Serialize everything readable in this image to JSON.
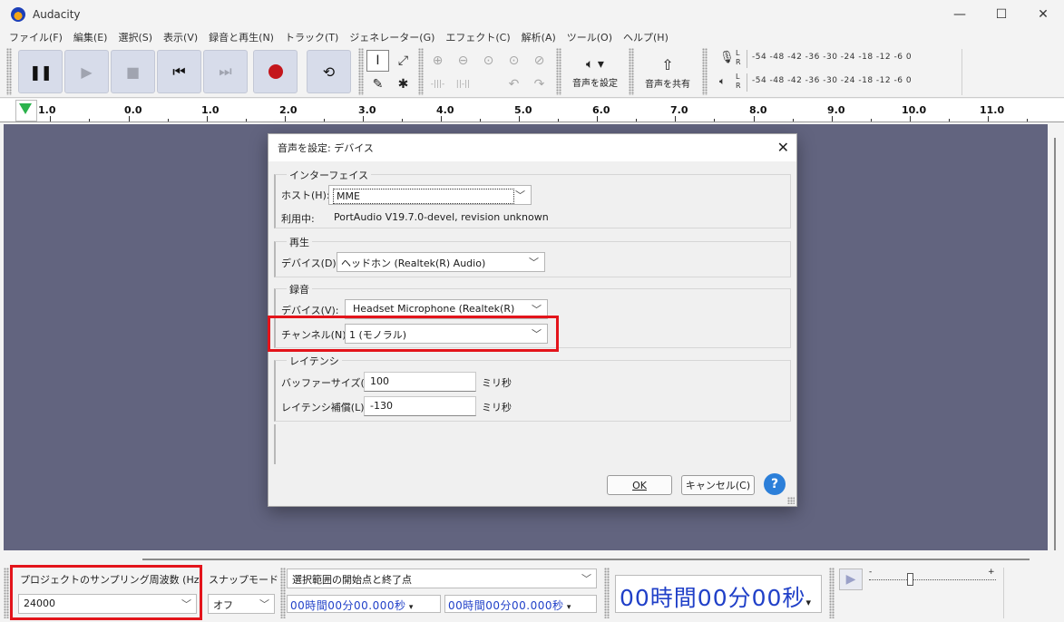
{
  "window": {
    "title": "Audacity",
    "minimize": "—",
    "maximize": "☐",
    "close": "✕"
  },
  "menu": [
    "ファイル(F)",
    "編集(E)",
    "選択(S)",
    "表示(V)",
    "録音と再生(N)",
    "トラック(T)",
    "ジェネレーター(G)",
    "エフェクト(C)",
    "解析(A)",
    "ツール(O)",
    "ヘルプ(H)"
  ],
  "toolbar": {
    "audio_setup_label": "音声を設定",
    "share_audio_label": "音声を共有",
    "meter_scale": "-54  -48  -42  -36  -30  -24  -18  -12   -6   0",
    "meter_lr": "L\nR"
  },
  "ruler": {
    "ticks": [
      "1.0",
      "0.0",
      "1.0",
      "2.0",
      "3.0",
      "4.0",
      "5.0",
      "6.0",
      "7.0",
      "8.0",
      "9.0",
      "10.0",
      "11.0"
    ]
  },
  "dialog": {
    "title": "音声を設定: デバイス",
    "interface": {
      "group_label": "インターフェイス",
      "host_label": "ホスト(H):",
      "host_value": "MME",
      "using_label": "利用中:",
      "using_value": "PortAudio V19.7.0-devel, revision unknown"
    },
    "playback": {
      "group_label": "再生",
      "device_label": "デバイス(D):",
      "device_value": "ヘッドホン (Realtek(R) Audio)"
    },
    "recording": {
      "group_label": "録音",
      "device_label": "デバイス(V):",
      "device_value": "Headset Microphone (Realtek(R)",
      "channels_label": "チャンネル(N):",
      "channels_value": "1 (モノラル)"
    },
    "latency": {
      "group_label": "レイテンシ",
      "buffer_label": "バッファーサイズ(B):",
      "buffer_value": "100",
      "buffer_unit": "ミリ秒",
      "compensation_label": "レイテンシ補償(L):",
      "compensation_value": "-130",
      "compensation_unit": "ミリ秒"
    },
    "ok_label": "OK",
    "cancel_label": "キャンセル(C)",
    "help_label": "?"
  },
  "bottom": {
    "project_rate_label": "プロジェクトのサンプリング周波数 (Hz)",
    "project_rate_value": "24000",
    "snap_label": "スナップモード",
    "snap_value": "オフ",
    "selection_mode_value": "選択範囲の開始点と終了点",
    "sel_start": "00時間00分00.000秒",
    "sel_end": "00時間00分00.000秒",
    "big_time": "00時間00分00秒"
  }
}
